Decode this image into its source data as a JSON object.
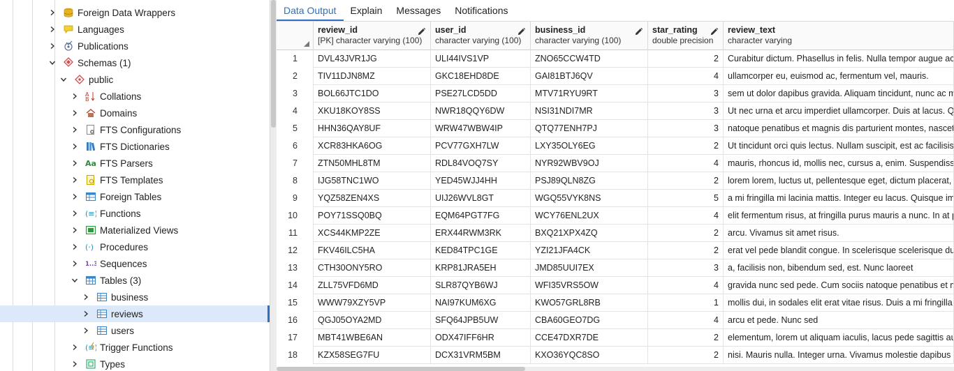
{
  "tree": {
    "items": [
      {
        "label": "Foreign Data Wrappers",
        "icon": "foreign-data-wrapper-icon",
        "expanded": false
      },
      {
        "label": "Languages",
        "icon": "languages-icon",
        "expanded": false
      },
      {
        "label": "Publications",
        "icon": "publications-icon",
        "expanded": false
      },
      {
        "label": "Schemas (1)",
        "icon": "schemas-icon",
        "expanded": true
      },
      {
        "label": "public",
        "icon": "schema-icon",
        "expanded": true
      },
      {
        "label": "Collations",
        "icon": "collations-icon",
        "expanded": false
      },
      {
        "label": "Domains",
        "icon": "domains-icon",
        "expanded": false
      },
      {
        "label": "FTS Configurations",
        "icon": "fts-configurations-icon",
        "expanded": false
      },
      {
        "label": "FTS Dictionaries",
        "icon": "fts-dictionaries-icon",
        "expanded": false
      },
      {
        "label": "FTS Parsers",
        "icon": "fts-parsers-icon",
        "icon_text": "Aa",
        "expanded": false
      },
      {
        "label": "FTS Templates",
        "icon": "fts-templates-icon",
        "expanded": false
      },
      {
        "label": "Foreign Tables",
        "icon": "foreign-tables-icon",
        "expanded": false
      },
      {
        "label": "Functions",
        "icon": "functions-icon",
        "expanded": false
      },
      {
        "label": "Materialized Views",
        "icon": "materialized-views-icon",
        "expanded": false
      },
      {
        "label": "Procedures",
        "icon": "procedures-icon",
        "expanded": false
      },
      {
        "label": "Sequences",
        "icon": "sequences-icon",
        "icon_text": "1..3",
        "expanded": false
      },
      {
        "label": "Tables (3)",
        "icon": "tables-icon",
        "expanded": true
      },
      {
        "label": "business",
        "icon": "table-icon",
        "expanded": false
      },
      {
        "label": "reviews",
        "icon": "table-icon",
        "expanded": false,
        "selected": true
      },
      {
        "label": "users",
        "icon": "table-icon",
        "expanded": false
      },
      {
        "label": "Trigger Functions",
        "icon": "trigger-functions-icon",
        "expanded": false
      },
      {
        "label": "Types",
        "icon": "types-icon",
        "expanded": false
      }
    ]
  },
  "tabs": [
    {
      "label": "Data Output",
      "active": true
    },
    {
      "label": "Explain",
      "active": false
    },
    {
      "label": "Messages",
      "active": false
    },
    {
      "label": "Notifications",
      "active": false
    }
  ],
  "grid": {
    "columns": [
      {
        "name": "review_id",
        "type": "[PK] character varying (100)",
        "editable": true
      },
      {
        "name": "user_id",
        "type": "character varying (100)",
        "editable": true
      },
      {
        "name": "business_id",
        "type": "character varying (100)",
        "editable": true
      },
      {
        "name": "star_rating",
        "type": "double precision",
        "editable": true
      },
      {
        "name": "review_text",
        "type": "character varying",
        "editable": false
      }
    ],
    "rows": [
      [
        "1",
        "DVL43JVR1JG",
        "ULI44IVS1VP",
        "ZNO65CCW4TD",
        "2",
        "Curabitur dictum. Phasellus in felis. Nulla tempor augue ac"
      ],
      [
        "2",
        "TIV11DJN8MZ",
        "GKC18EHD8DE",
        "GAI81BTJ6QV",
        "4",
        "ullamcorper eu, euismod ac, fermentum vel, mauris."
      ],
      [
        "3",
        "BOL66JTC1DO",
        "PSE27LCD5DD",
        "MTV71RYU9RT",
        "3",
        "sem ut dolor dapibus gravida. Aliquam tincidunt, nunc ac m"
      ],
      [
        "4",
        "XKU18KOY8SS",
        "NWR18QQY6DW",
        "NSI31NDI7MR",
        "3",
        "Ut nec urna et arcu imperdiet ullamcorper. Duis at lacus. Qu"
      ],
      [
        "5",
        "HHN36QAY8UF",
        "WRW47WBW4IP",
        "QTQ77ENH7PJ",
        "3",
        "natoque penatibus et magnis dis parturient montes, nascetu"
      ],
      [
        "6",
        "XCR83HKA6OG",
        "PCV77GXH7LW",
        "LXY35OLY6EG",
        "2",
        "Ut tincidunt orci quis lectus. Nullam suscipit, est ac facilisis"
      ],
      [
        "7",
        "ZTN50MHL8TM",
        "RDL84VOQ7SY",
        "NYR92WBV9OJ",
        "4",
        "mauris, rhoncus id, mollis nec, cursus a, enim. Suspendisse"
      ],
      [
        "8",
        "IJG58TNC1WO",
        "YED45WJJ4HH",
        "PSJ89QLN8ZG",
        "2",
        "lorem lorem, luctus ut, pellentesque eget, dictum placerat, a"
      ],
      [
        "9",
        "YQZ58ZEN4XS",
        "UIJ26WVL8GT",
        "WGQ55VYK8NS",
        "5",
        "a mi fringilla mi lacinia mattis. Integer eu lacus. Quisque imp"
      ],
      [
        "10",
        "POY71SSQ0BQ",
        "EQM64PGT7FG",
        "WCY76ENL2UX",
        "4",
        "elit fermentum risus, at fringilla purus mauris a nunc. In at p"
      ],
      [
        "11",
        "XCS44KMP2ZE",
        "ERX44RWM3RK",
        "BXQ21XPX4ZQ",
        "2",
        "arcu. Vivamus sit amet risus."
      ],
      [
        "12",
        "FKV46ILC5HA",
        "KED84TPC1GE",
        "YZI21JFA4CK",
        "2",
        "erat vel pede blandit congue. In scelerisque scelerisque dui."
      ],
      [
        "13",
        "CTH30ONY5RO",
        "KRP81JRA5EH",
        "JMD85UUI7EX",
        "3",
        "a, facilisis non, bibendum sed, est. Nunc laoreet"
      ],
      [
        "14",
        "ZLL75VFD6MD",
        "SLR87QYB6WJ",
        "WFI35VRS5OW",
        "4",
        "gravida nunc sed pede. Cum sociis natoque penatibus et ma"
      ],
      [
        "15",
        "WWW79XZY5VP",
        "NAI97KUM6XG",
        "KWO57GRL8RB",
        "1",
        "mollis dui, in sodales elit erat vitae risus. Duis a mi fringilla r"
      ],
      [
        "16",
        "QGJ05OYA2MD",
        "SFQ64JPB5UW",
        "CBA60GEO7DG",
        "4",
        "arcu et pede. Nunc sed"
      ],
      [
        "17",
        "MBT41WBE6AN",
        "ODX47IFF6HR",
        "CCE47DXR7DE",
        "2",
        "elementum, lorem ut aliquam iaculis, lacus pede sagittis au"
      ],
      [
        "18",
        "KZX58SEG7FU",
        "DCX31VRM5BM",
        "KXO36YQC8SO",
        "2",
        "nisi. Mauris nulla. Integer urna. Vivamus molestie dapibus l"
      ]
    ]
  },
  "colors": {
    "accent": "#2c6fc3",
    "selected_row": "#dbe9fb"
  }
}
